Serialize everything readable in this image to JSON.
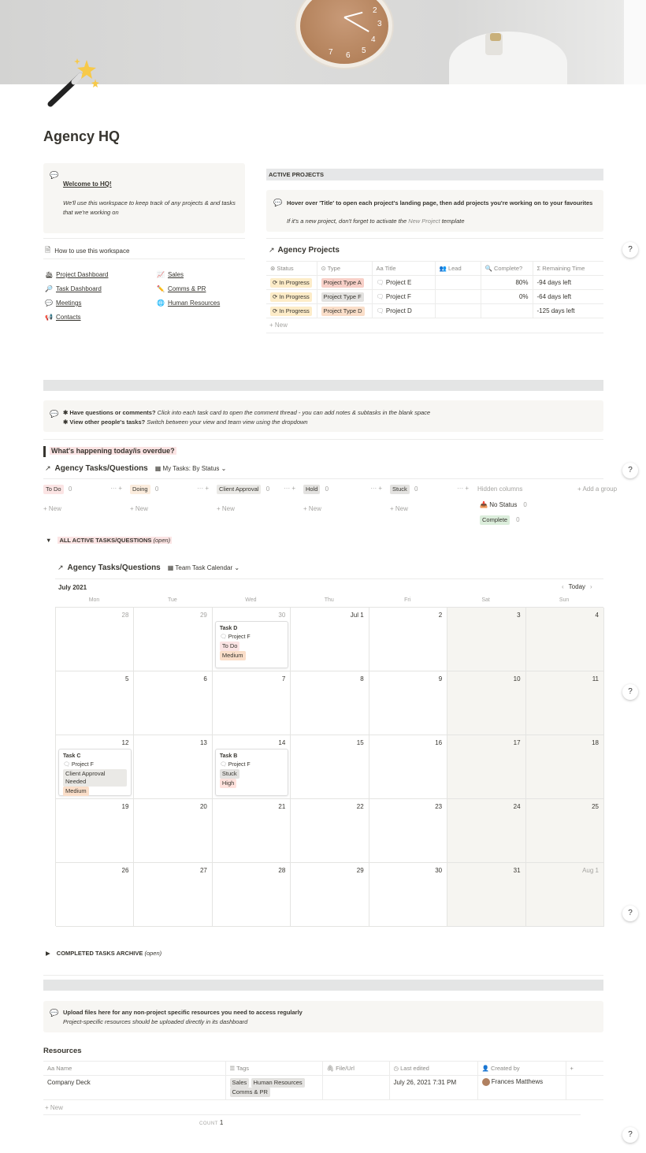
{
  "page": {
    "title": "Agency HQ",
    "icon": "magic-wand-icon"
  },
  "welcome": {
    "heading": "Welcome to HQ!",
    "body": "We'll use this workspace to keep track of any projects &  and tasks that we're working on",
    "howto": "How to use this workspace"
  },
  "nav": {
    "left": [
      "Project Dashboard",
      "Task Dashboard",
      "Meetings",
      "Contacts"
    ],
    "right": [
      "Sales",
      "Comms & PR",
      "Human Resources"
    ]
  },
  "active_projects": {
    "header": "ACTIVE PROJECTS",
    "callout_line1": "Hover over 'Title' to open each project's landing page, then add projects you're working on to your favourites",
    "callout_line2a": "If it's a new project, don't forget to activate the ",
    "callout_line2b": "New Project",
    "callout_line2c": " template",
    "db_title": "Agency Projects",
    "columns": [
      "Status",
      "Type",
      "Title",
      "Lead",
      "Complete?",
      "Remaining Time"
    ],
    "rows": [
      {
        "status": "In Progress",
        "type": "Project Type A",
        "title": "Project E",
        "lead": "",
        "complete": "80%",
        "remaining": "-94 days left"
      },
      {
        "status": "In Progress",
        "type": "Project Type F",
        "title": "Project F",
        "lead": "",
        "complete": "0%",
        "remaining": "-64 days left"
      },
      {
        "status": "In Progress",
        "type": "Project Type D",
        "title": "Project D",
        "lead": "",
        "complete": "",
        "remaining": "-125 days left"
      }
    ],
    "new_label": "New"
  },
  "tasks_callout": {
    "line1_bold": "✱ Have questions or comments?",
    "line1": " Click into each task card to open the comment thread - you can add notes & subtasks in the blank space",
    "line2_bold": "✱ View other people's tasks?",
    "line2": " Switch between your view and team view using the dropdown"
  },
  "today_heading": "What's happening today/is overdue?",
  "kanban": {
    "db_title": "Agency Tasks/Questions",
    "view": "My Tasks: By Status",
    "groups": [
      {
        "name": "To Do",
        "count": "0",
        "color": "#fbe4e4"
      },
      {
        "name": "Doing",
        "count": "0",
        "color": "#fbecdd"
      },
      {
        "name": "Client Approval",
        "count": "0",
        "color": "#eae9e6"
      },
      {
        "name": "Hold",
        "count": "0",
        "color": "#e3e2e0"
      },
      {
        "name": "Stuck",
        "count": "0",
        "color": "#e3e2e0"
      }
    ],
    "new_label": "New",
    "hidden_columns": "Hidden columns",
    "add_group": "Add a group",
    "hidden": [
      {
        "name": "No Status",
        "count": "0"
      },
      {
        "name": "Complete",
        "count": "0"
      }
    ]
  },
  "active_toggle": {
    "label": "ALL ACTIVE TASKS/QUESTIONS",
    "suffix": "(open)"
  },
  "calendar": {
    "db_title": "Agency Tasks/Questions",
    "view": "Team Task Calendar",
    "month": "July 2021",
    "today": "Today",
    "weekdays": [
      "Mon",
      "Tue",
      "Wed",
      "Thu",
      "Fri",
      "Sat",
      "Sun"
    ],
    "days": [
      [
        "28",
        "29",
        "30",
        "Jul 1",
        "2",
        "3",
        "4"
      ],
      [
        "5",
        "6",
        "7",
        "8",
        "9",
        "10",
        "11"
      ],
      [
        "12",
        "13",
        "14",
        "15",
        "16",
        "17",
        "18"
      ],
      [
        "19",
        "20",
        "21",
        "22",
        "23",
        "24",
        "25"
      ],
      [
        "26",
        "27",
        "28",
        "29",
        "30",
        "31",
        "Aug 1"
      ]
    ],
    "cards": [
      {
        "title": "Task D",
        "project": "Project F",
        "status": "To Do",
        "priority": "Medium"
      },
      {
        "title": "Task C",
        "project": "Project F",
        "status": "Client Approval Needed",
        "priority": "Medium"
      },
      {
        "title": "Task B",
        "project": "Project F",
        "status": "Stuck",
        "priority": "High"
      }
    ]
  },
  "archive_toggle": {
    "label": "COMPLETED TASKS ARCHIVE",
    "suffix": "(open)"
  },
  "upload_callout": {
    "line1": "Upload files here for any non-project specific resources you need to access regularly",
    "line2": "Project-specific resources should be uploaded directly in its dashboard"
  },
  "resources": {
    "title": "Resources",
    "columns": [
      "Name",
      "Tags",
      "File/Url",
      "Last edited",
      "Created by"
    ],
    "row": {
      "name": "Company Deck",
      "tags": [
        "Sales",
        "Human Resources",
        "Comms & PR"
      ],
      "file": "",
      "edited": "July 26, 2021 7:31 PM",
      "creator": "Frances Matthews"
    },
    "new_label": "New",
    "count_label": "COUNT",
    "count": "1"
  },
  "help_label": "?"
}
